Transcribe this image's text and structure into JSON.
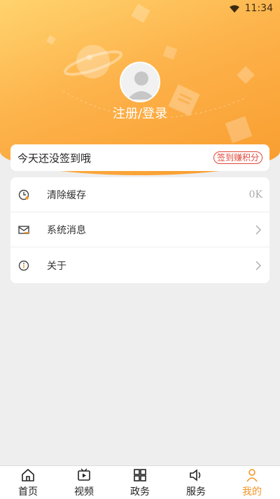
{
  "status_bar": {
    "time": "11:34"
  },
  "profile": {
    "login_label": "注册/登录"
  },
  "sign_in": {
    "text": "今天还没签到哦",
    "button_label": "签到赚积分"
  },
  "menu": [
    {
      "label": "清除缓存",
      "value": "0K",
      "icon": "clock-icon"
    },
    {
      "label": "系统消息",
      "value": "",
      "icon": "mail-icon"
    },
    {
      "label": "关于",
      "value": "",
      "icon": "info-icon"
    }
  ],
  "tabs": [
    {
      "label": "首页",
      "icon": "home-icon",
      "active": false
    },
    {
      "label": "视频",
      "icon": "video-icon",
      "active": false
    },
    {
      "label": "政务",
      "icon": "grid-icon",
      "active": false
    },
    {
      "label": "服务",
      "icon": "speaker-icon",
      "active": false
    },
    {
      "label": "我的",
      "icon": "user-icon",
      "active": true
    }
  ],
  "colors": {
    "accent": "#f2962a",
    "header_start": "#ffd36e",
    "header_end": "#f89c2e",
    "sign_red": "#e0473a"
  }
}
